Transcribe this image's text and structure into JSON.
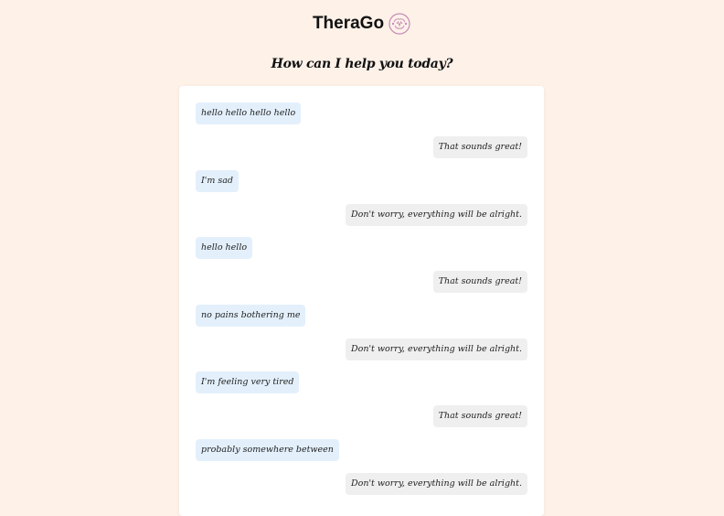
{
  "app": {
    "title": "TheraGo",
    "logo_icon": "brain-heart-logo-icon"
  },
  "prompt": {
    "heading": "How can I help you today?"
  },
  "chat": {
    "messages": [
      {
        "sender": "user",
        "text": "hello hello hello hello"
      },
      {
        "sender": "bot",
        "text": "That sounds great!"
      },
      {
        "sender": "user",
        "text": "I'm sad"
      },
      {
        "sender": "bot",
        "text": "Don't worry, everything will be alright."
      },
      {
        "sender": "user",
        "text": "hello hello"
      },
      {
        "sender": "bot",
        "text": "That sounds great!"
      },
      {
        "sender": "user",
        "text": "no pains bothering me"
      },
      {
        "sender": "bot",
        "text": "Don't worry, everything will be alright."
      },
      {
        "sender": "user",
        "text": "I'm feeling very tired"
      },
      {
        "sender": "bot",
        "text": "That sounds great!"
      },
      {
        "sender": "user",
        "text": "probably somewhere between"
      },
      {
        "sender": "bot",
        "text": "Don't worry, everything will be alright."
      }
    ]
  },
  "colors": {
    "page_background": "#fdf1e8",
    "user_bubble": "#e3f0fc",
    "bot_bubble": "#efefef",
    "logo_accent": "#c78bb8"
  }
}
